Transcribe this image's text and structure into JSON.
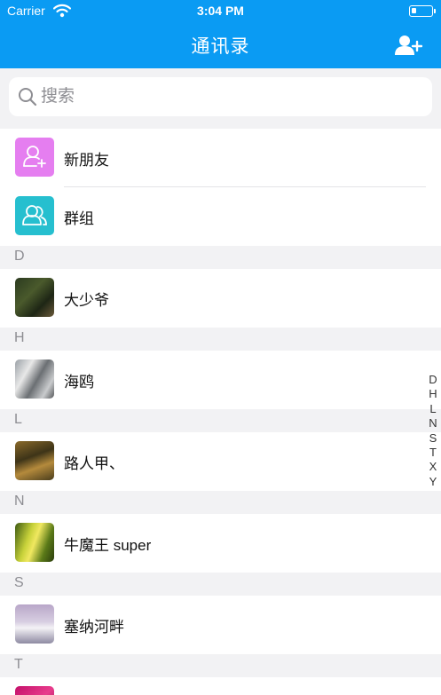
{
  "status_bar": {
    "carrier": "Carrier",
    "time": "3:04 PM"
  },
  "nav": {
    "title": "通讯录",
    "add_friend_icon": "add-friend-icon"
  },
  "search": {
    "placeholder": "搜索",
    "value": ""
  },
  "top_items": [
    {
      "label": "新朋友",
      "icon": "new-friend-icon",
      "color": "#e57ef0"
    },
    {
      "label": "群组",
      "icon": "group-icon",
      "color": "#26bfcf"
    }
  ],
  "sections": [
    {
      "letter": "D",
      "contacts": [
        {
          "name": "大少爷"
        }
      ]
    },
    {
      "letter": "H",
      "contacts": [
        {
          "name": "海鸥"
        }
      ]
    },
    {
      "letter": "L",
      "contacts": [
        {
          "name": "路人甲、"
        }
      ]
    },
    {
      "letter": "N",
      "contacts": [
        {
          "name": "牛魔王 super"
        }
      ]
    },
    {
      "letter": "S",
      "contacts": [
        {
          "name": "塞纳河畔"
        }
      ]
    },
    {
      "letter": "T",
      "contacts": []
    }
  ],
  "index_letters": [
    "D",
    "H",
    "L",
    "N",
    "S",
    "T",
    "X",
    "Y"
  ],
  "colors": {
    "nav_blue": "#0a9bf3",
    "section_bg": "#f2f2f4"
  }
}
